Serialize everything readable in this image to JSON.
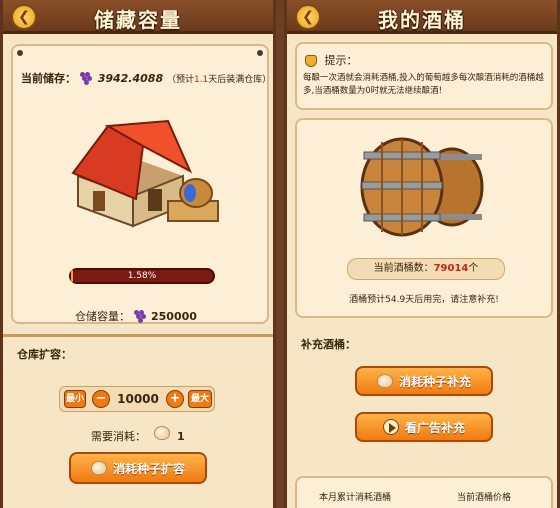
{
  "left": {
    "title": "储藏容量",
    "current_stock_label": "当前储存：",
    "current_stock_value": "3942.4088",
    "forecast_prefix": "（预计",
    "forecast_days": "1.1",
    "forecast_suffix": "天后装满仓库）",
    "progress_text": "1.58%",
    "progress_fraction": 0.0158,
    "capacity_label": "仓储容量：",
    "capacity_value": "250000",
    "expand_label": "仓库扩容：",
    "min_label": "最小",
    "minus_symbol": "−",
    "stepper_value": "10000",
    "plus_symbol": "+",
    "max_label": "最大",
    "cost_label": "需要消耗：",
    "cost_value": "1",
    "expand_button": "消耗种子扩容"
  },
  "right": {
    "title": "我的酒桶",
    "tip_title": "提示：",
    "tip_text": "每酿一次酒就会消耗酒桶,投入的葡萄越多每次酿酒消耗的酒桶越多,当酒桶数量为0时就无法继续酿酒!",
    "barrel_count_label": "当前酒桶数：",
    "barrel_count_value": "79014",
    "barrel_count_unit": "个",
    "forecast_text": "酒桶预计54.9天后用完，请注意补充!",
    "refill_label": "补充酒桶：",
    "seed_refill_button": "消耗种子补充",
    "ad_refill_button": "看广告补充",
    "footer_left": "本月累计消耗酒桶",
    "footer_right": "当前酒桶价格"
  },
  "colors": {
    "bg_brown": "#6b3f22",
    "panel_cream": "#f6e6c6",
    "progress_red": "#7a1a10",
    "accent_orange": "#f07a12",
    "highlight_red": "#d0201a"
  }
}
